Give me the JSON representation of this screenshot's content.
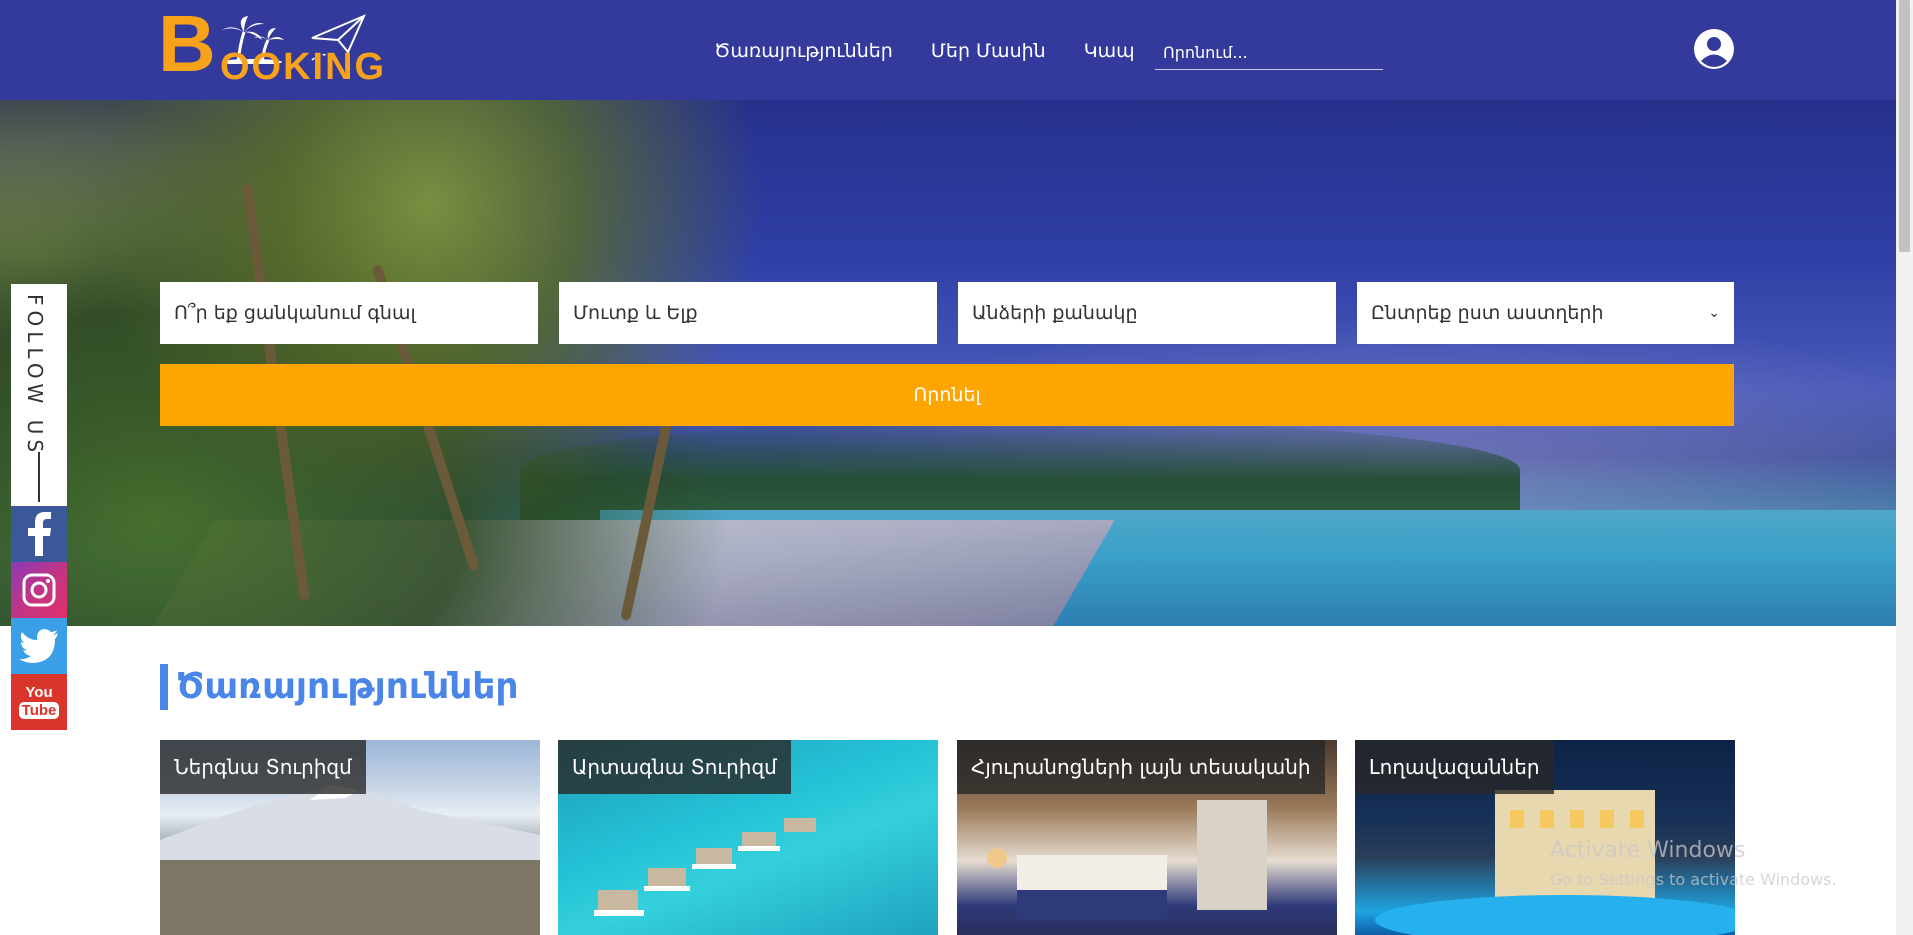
{
  "header": {
    "logo_initial": "B",
    "logo_rest": "OOKING",
    "nav": [
      "Ծառայություններ",
      "Մեր Մասին",
      "Կապ"
    ],
    "search_placeholder": "Որոնում...",
    "user_icon": "user-circle-icon"
  },
  "hero": {
    "destination_placeholder": "Ո՞ր եք ցանկանում գնալ",
    "dates_placeholder": "Մուտք և Ելք",
    "guests_placeholder": "Անձերի քանակը",
    "stars_select": "Ընտրեք ըստ աստղերի",
    "search_button": "Որոնել"
  },
  "follow": {
    "label": "FOLLOW US",
    "icons": [
      "facebook-icon",
      "instagram-icon",
      "twitter-icon",
      "youtube-icon"
    ],
    "youtube_top": "You",
    "youtube_bottom": "Tube"
  },
  "services": {
    "title": "Ծառայություններ",
    "cards": [
      "Ներգնա Տուրիզմ",
      "Արտագնա Տուրիզմ",
      "Հյուրանոցների լայն տեսականի",
      "Լողավազաններ"
    ]
  },
  "watermark": {
    "line1": "Activate Windows",
    "line2": "Go to Settings to activate Windows."
  },
  "colors": {
    "header": "#343a9c",
    "accent": "#ffa500",
    "title": "#4a86e8"
  }
}
